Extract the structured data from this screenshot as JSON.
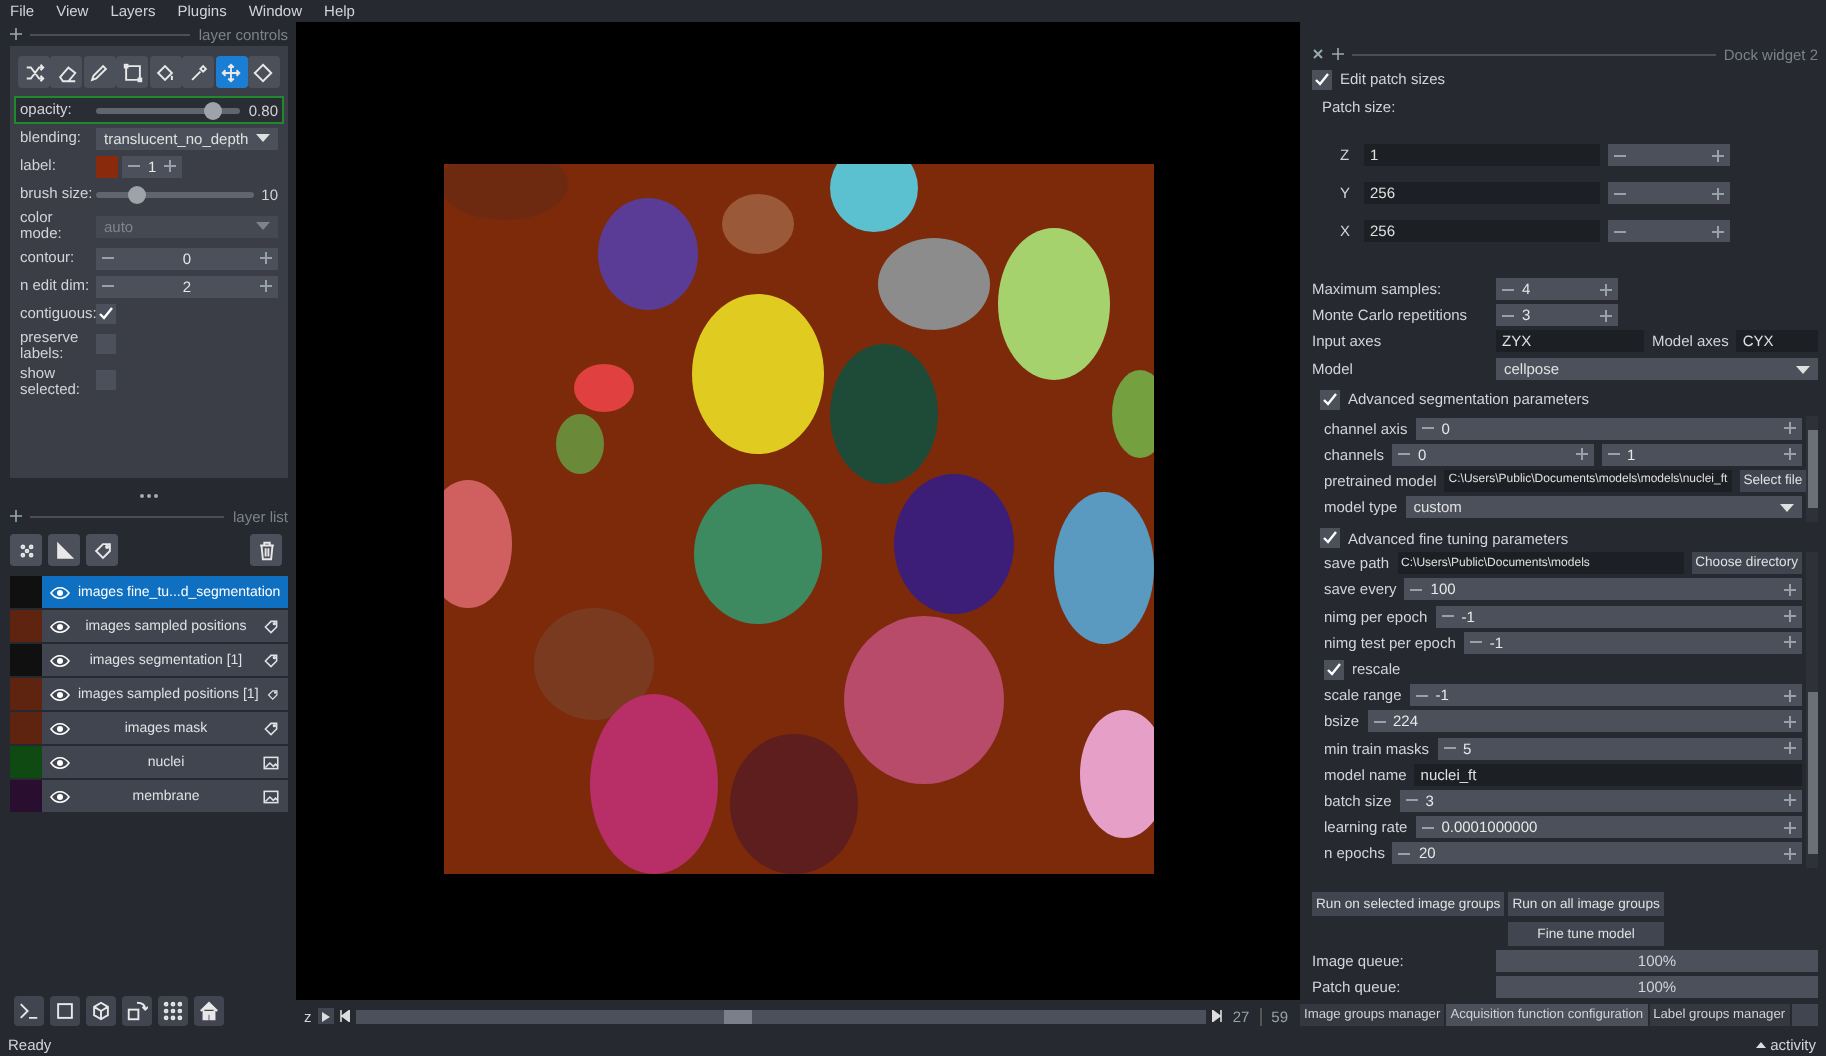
{
  "menu": [
    "File",
    "View",
    "Layers",
    "Plugins",
    "Window",
    "Help"
  ],
  "layer_controls": {
    "title": "layer controls",
    "tools": [
      {
        "kind": "shuffle",
        "selected": false
      },
      {
        "kind": "erase",
        "selected": false
      },
      {
        "kind": "paint",
        "selected": false
      },
      {
        "kind": "polygon",
        "selected": false
      },
      {
        "kind": "fill",
        "selected": false
      },
      {
        "kind": "picker",
        "selected": false
      },
      {
        "kind": "pan_zoom",
        "selected": true
      },
      {
        "kind": "transform",
        "selected": false
      }
    ],
    "rows": [
      {
        "kind": "slider",
        "label": "opacity:",
        "level": 0.8,
        "reading": "0.80",
        "focused": true
      },
      {
        "kind": "dropdown",
        "label": "blending:",
        "value": "translucent_no_depth",
        "disabled": false
      },
      {
        "kind": "color_spin",
        "label": "label:",
        "color": "#8a2a0c",
        "value": "1"
      },
      {
        "kind": "slider",
        "label": "brush size:",
        "level": 0.25,
        "reading": "10",
        "focused": false
      },
      {
        "kind": "dropdown",
        "label": "color mode:",
        "value": "auto",
        "disabled": true
      },
      {
        "kind": "spin",
        "label": "contour:",
        "value": "0"
      },
      {
        "kind": "spin",
        "label": "n edit dim:",
        "value": "2"
      },
      {
        "kind": "checkbox",
        "label": "contiguous:",
        "checked": true
      },
      {
        "kind": "checkbox",
        "label": "preserve labels:",
        "checked": false
      },
      {
        "kind": "checkbox",
        "label": "show selected:",
        "checked": false
      }
    ]
  },
  "layer_list": {
    "title": "layer list",
    "new_layer_buttons": [
      {
        "kind": "points"
      },
      {
        "kind": "shapes"
      },
      {
        "kind": "labels"
      }
    ],
    "layers": [
      {
        "name": "images fine_tu...d_segmentation",
        "kind": "labels",
        "color": "#101010",
        "selected": true,
        "visible": true
      },
      {
        "name": "images sampled positions",
        "kind": "labels",
        "color": "#5e2410",
        "selected": false,
        "visible": true
      },
      {
        "name": "images segmentation [1]",
        "kind": "labels",
        "color": "#101010",
        "selected": false,
        "visible": true
      },
      {
        "name": "images sampled positions [1]",
        "kind": "labels",
        "color": "#5e2410",
        "selected": false,
        "visible": true
      },
      {
        "name": "images mask",
        "kind": "labels",
        "color": "#5e2410",
        "selected": false,
        "visible": true
      },
      {
        "name": "nuclei",
        "kind": "image",
        "color": "#0e4a12",
        "selected": false,
        "visible": true
      },
      {
        "name": "membrane",
        "kind": "image",
        "color": "#2a0e30",
        "selected": false,
        "visible": true
      }
    ]
  },
  "viewer_buttons": [
    {
      "kind": "console"
    },
    {
      "kind": "ndisplay"
    },
    {
      "kind": "roll"
    },
    {
      "kind": "transpose"
    },
    {
      "kind": "grid"
    },
    {
      "kind": "home"
    }
  ],
  "dims_slider": {
    "axis": "z",
    "level": 0.45,
    "current": "27",
    "total": "59"
  },
  "dock": {
    "title": "Dock widget 2",
    "edit_patch_sizes": {
      "label": "Edit patch sizes",
      "checked": true
    },
    "patch_size_label": "Patch size:",
    "patch_sizes": [
      {
        "axis": "Z",
        "value": "1"
      },
      {
        "axis": "Y",
        "value": "256"
      },
      {
        "axis": "X",
        "value": "256"
      }
    ],
    "max_samples": {
      "label": "Maximum samples:",
      "value": "4"
    },
    "monte_carlo": {
      "label": "Monte Carlo repetitions",
      "value": "3"
    },
    "input_axes": {
      "label": "Input axes",
      "value": "ZYX"
    },
    "model_axes": {
      "label": "Model axes",
      "value": "CYX"
    },
    "model": {
      "label": "Model",
      "value": "cellpose"
    },
    "segmentation": {
      "label": "Advanced segmentation parameters",
      "checked": true,
      "rows": [
        {
          "kind": "spin",
          "label": "channel axis",
          "value": "0"
        },
        {
          "kind": "spin_pair",
          "label": "channels",
          "values": [
            "0",
            "1"
          ]
        },
        {
          "kind": "file",
          "label": "pretrained model",
          "value": "C:\\Users\\Public\\Documents\\models\\models\\nuclei_ft",
          "button": "Select file"
        },
        {
          "kind": "dropdown",
          "label": "model type",
          "value": "custom"
        }
      ]
    },
    "fine_tuning": {
      "label": "Advanced fine tuning parameters",
      "checked": true,
      "rows": [
        {
          "kind": "file",
          "label": "save path",
          "value": "C:\\Users\\Public\\Documents\\models",
          "button": "Choose directory"
        },
        {
          "kind": "spin",
          "label": "save every",
          "value": "100"
        },
        {
          "kind": "spin",
          "label": "nimg per epoch",
          "value": "-1"
        },
        {
          "kind": "spin",
          "label": "nimg test per epoch",
          "value": "-1"
        },
        {
          "kind": "checkbox",
          "label": "rescale",
          "checked": true
        },
        {
          "kind": "spin",
          "label": "scale range",
          "value": "-1"
        },
        {
          "kind": "spin",
          "label": "bsize",
          "value": "224"
        },
        {
          "kind": "spin",
          "label": "min train masks",
          "value": "5"
        },
        {
          "kind": "text",
          "label": "model name",
          "value": "nuclei_ft"
        },
        {
          "kind": "spin",
          "label": "batch size",
          "value": "3"
        },
        {
          "kind": "spin",
          "label": "learning rate",
          "value": "0.0001000000"
        },
        {
          "kind": "spin",
          "label": "n epochs",
          "value": "20"
        }
      ]
    },
    "buttons": [
      "Run on selected image groups",
      "Run on all image groups",
      "Fine tune model"
    ],
    "queues": [
      {
        "label": "Image queue:",
        "level": 1,
        "reading": "100%"
      },
      {
        "label": "Patch queue:",
        "level": 1,
        "reading": "100%"
      }
    ],
    "tabs": [
      {
        "label": "Image groups manager",
        "selected": false
      },
      {
        "label": "Acquisition function configuration",
        "selected": true
      },
      {
        "label": "Label groups manager",
        "selected": false
      }
    ]
  },
  "status": {
    "message": "Ready",
    "activity": "activity"
  }
}
